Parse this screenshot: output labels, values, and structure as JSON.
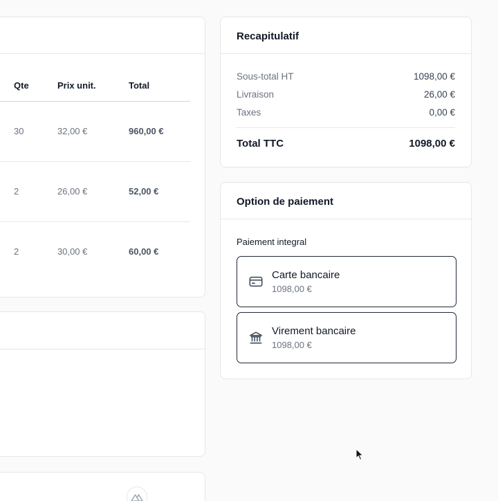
{
  "items": {
    "columns": {
      "qty": "Qte",
      "unit_price": "Prix unit.",
      "total": "Total"
    },
    "rows": [
      {
        "qty": "30",
        "unit_price": "32,00 €",
        "total": "960,00 €"
      },
      {
        "qty": "2",
        "unit_price": "26,00 €",
        "total": "52,00 €"
      },
      {
        "qty": "2",
        "unit_price": "30,00 €",
        "total": "60,00 €"
      }
    ]
  },
  "summary": {
    "title": "Recapitulatif",
    "lines": [
      {
        "label": "Sous-total HT",
        "value": "1098,00 €"
      },
      {
        "label": "Livraison",
        "value": "26,00 €"
      },
      {
        "label": "Taxes",
        "value": "0,00 €"
      }
    ],
    "total_label": "Total TTC",
    "total_value": "1098,00 €"
  },
  "payment": {
    "title": "Option de paiement",
    "subtitle": "Paiement integral",
    "options": [
      {
        "name": "Carte bancaire",
        "amount": "1098,00 €",
        "icon": "credit-card-icon"
      },
      {
        "name": "Virement bancaire",
        "amount": "1098,00 €",
        "icon": "bank-icon"
      }
    ]
  },
  "colors": {
    "border": "#e5e7eb",
    "text": "#111827",
    "muted": "#6b7280",
    "option_border": "#1f2937"
  }
}
